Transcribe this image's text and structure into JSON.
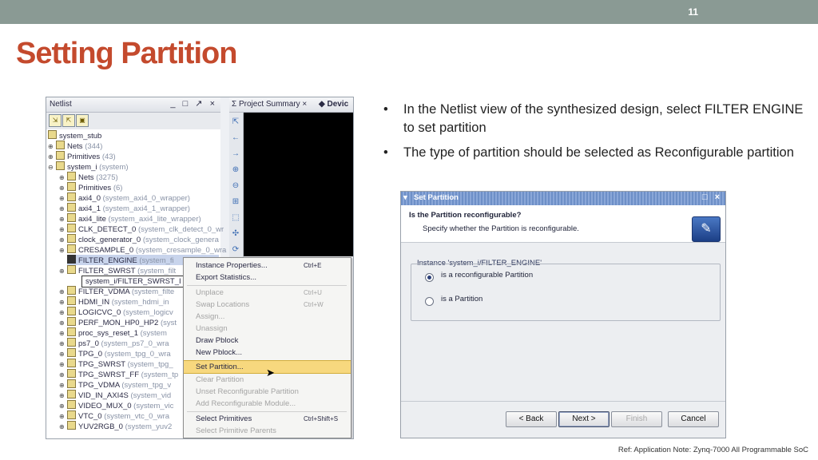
{
  "slide": {
    "number": "11",
    "title": "Setting Partition",
    "bullets": [
      "In the Netlist view of the synthesized design, select FILTER ENGINE to set partition",
      "The type of partition should be selected as Reconfigurable partition"
    ],
    "ref": "Ref: Application Note: Zynq-7000 All Programmable SoC",
    "title_color": "#c44a2d",
    "bar_color": "#8a9a94"
  },
  "netlist": {
    "title": "Netlist",
    "controls": "_ □ ↗ ×",
    "tree": [
      {
        "label": "system_stub",
        "dim": ""
      },
      {
        "label": "Nets",
        "dim": "(344)"
      },
      {
        "label": "Primitives",
        "dim": "(43)"
      },
      {
        "label": "system_i",
        "dim": "(system)"
      },
      {
        "label": "Nets",
        "dim": "(3275)"
      },
      {
        "label": "Primitives",
        "dim": "(6)"
      },
      {
        "label": "axi4_0",
        "dim": "(system_axi4_0_wrapper)"
      },
      {
        "label": "axi4_1",
        "dim": "(system_axi4_1_wrapper)"
      },
      {
        "label": "axi4_lite",
        "dim": "(system_axi4_lite_wrapper)"
      },
      {
        "label": "CLK_DETECT_0",
        "dim": "(system_clk_detect_0_wr"
      },
      {
        "label": "clock_generator_0",
        "dim": "(system_clock_genera"
      },
      {
        "label": "CRESAMPLE_0",
        "dim": "(system_cresample_0_wra"
      },
      {
        "label": "FILTER_ENGINE",
        "dim": "(system_fi"
      },
      {
        "label": "FILTER_SWRST",
        "dim": "(system_filt"
      },
      {
        "label": "system_i/FILTER_SWRST_I",
        "dim": ""
      },
      {
        "label": "FILTER_VDMA",
        "dim": "(system_filte"
      },
      {
        "label": "HDMI_IN",
        "dim": "(system_hdmi_in"
      },
      {
        "label": "LOGICVC_0",
        "dim": "(system_logicv"
      },
      {
        "label": "PERF_MON_HP0_HP2",
        "dim": "(syst"
      },
      {
        "label": "proc_sys_reset_1",
        "dim": "(system"
      },
      {
        "label": "ps7_0",
        "dim": "(system_ps7_0_wra"
      },
      {
        "label": "TPG_0",
        "dim": "(system_tpg_0_wra"
      },
      {
        "label": "TPG_SWRST",
        "dim": "(system_tpg_"
      },
      {
        "label": "TPG_SWRST_FF",
        "dim": "(system_tp"
      },
      {
        "label": "TPG_VDMA",
        "dim": "(system_tpg_v"
      },
      {
        "label": "VID_IN_AXI4S",
        "dim": "(system_vid"
      },
      {
        "label": "VIDEO_MUX_0",
        "dim": "(system_vic"
      },
      {
        "label": "VTC_0",
        "dim": "(system_vtc_0_wra"
      },
      {
        "label": "YUV2RGB_0",
        "dim": "(system_yuv2"
      }
    ],
    "tabs": [
      "Project Summary",
      "Devic"
    ],
    "menu": [
      {
        "label": "Instance Properties...",
        "key": "Ctrl+E"
      },
      {
        "label": "Export Statistics...",
        "key": ""
      },
      {
        "label": "Unplace",
        "key": "Ctrl+U"
      },
      {
        "label": "Swap Locations",
        "key": "Ctrl+W"
      },
      {
        "label": "Assign...",
        "key": ""
      },
      {
        "label": "Unassign",
        "key": ""
      },
      {
        "label": "Draw Pblock",
        "key": ""
      },
      {
        "label": "New Pblock...",
        "key": ""
      },
      {
        "label": "Set Partition...",
        "key": ""
      },
      {
        "label": "Clear Partition",
        "key": ""
      },
      {
        "label": "Unset Reconfigurable Partition",
        "key": ""
      },
      {
        "label": "Add Reconfigurable Module...",
        "key": ""
      },
      {
        "label": "Select Primitives",
        "key": "Ctrl+Shift+S"
      },
      {
        "label": "Select Primitive Parents",
        "key": ""
      }
    ]
  },
  "dialog": {
    "title": "Set Partition",
    "question": "Is the Partition reconfigurable?",
    "subtitle": "Specify whether the Partition is reconfigurable.",
    "group_label": "Instance 'system_i/FILTER_ENGINE'",
    "options": [
      "is a reconfigurable Partition",
      "is a Partition"
    ],
    "buttons": {
      "back": "< Back",
      "next": "Next >",
      "finish": "Finish",
      "cancel": "Cancel"
    }
  }
}
